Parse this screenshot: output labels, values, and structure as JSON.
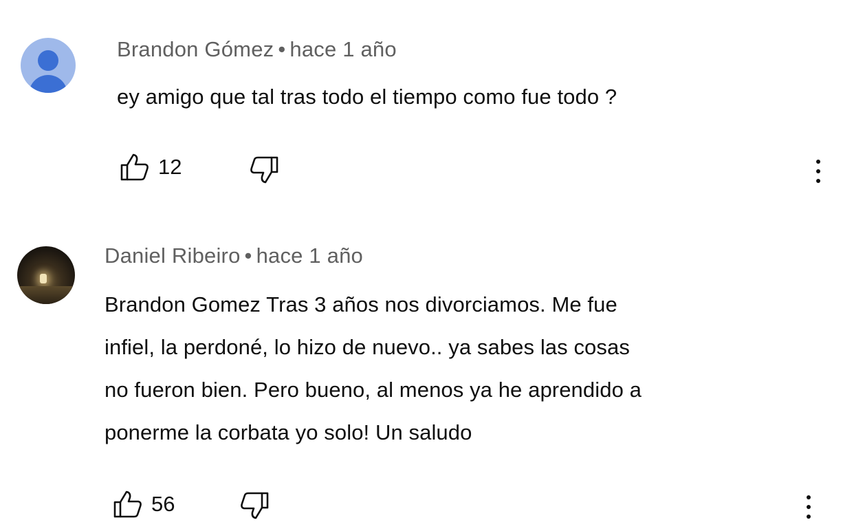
{
  "comments": [
    {
      "author": "Brandon Gómez",
      "separator": "•",
      "time": "hace 1 año",
      "lines": [
        "ey amigo que tal tras todo el tiempo como fue todo ?"
      ],
      "likes": "12",
      "avatar_icon": "default-user-avatar",
      "colors": {
        "avatar_bg": "#9fb9ea",
        "avatar_fg": "#3b6fd4"
      }
    },
    {
      "author": "Daniel Ribeiro",
      "separator": "•",
      "time": "hace 1 año",
      "lines": [
        "Brandon Gomez Tras 3 años nos divorciamos. Me fue",
        "infiel, la perdoné, lo hizo de nuevo.. ya sabes las cosas",
        "no fueron bien. Pero bueno, al menos ya he aprendido a",
        "ponerme la corbata yo solo! Un saludo"
      ],
      "likes": "56",
      "avatar_icon": "photo-avatar"
    }
  ],
  "icons": {
    "like": "thumbs-up-icon",
    "dislike": "thumbs-down-icon",
    "more": "more-vertical-icon"
  }
}
